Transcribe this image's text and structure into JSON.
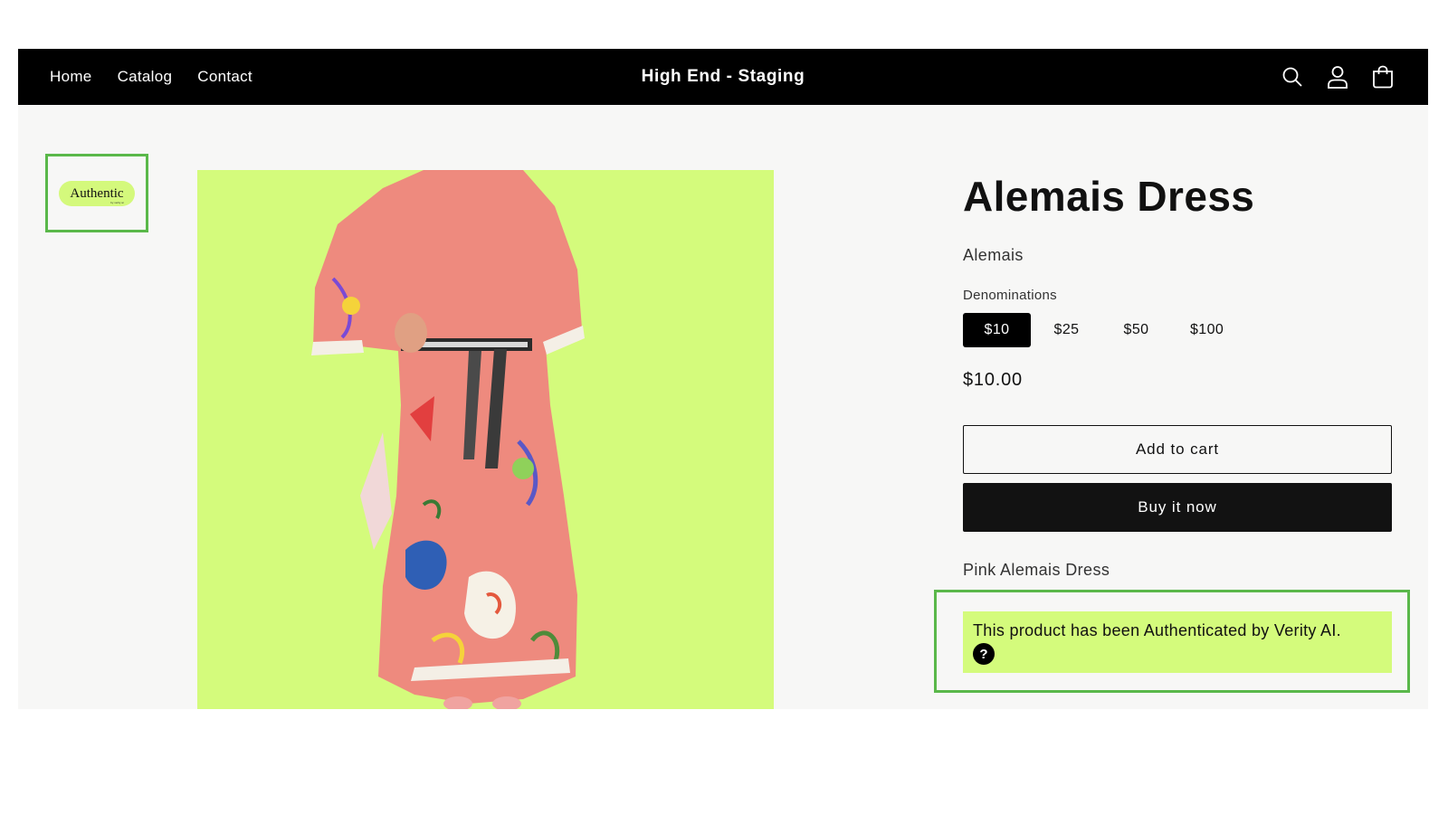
{
  "header": {
    "nav": [
      {
        "label": "Home"
      },
      {
        "label": "Catalog"
      },
      {
        "label": "Contact"
      }
    ],
    "brand": "High End - Staging",
    "icons": [
      "search-icon",
      "account-icon",
      "cart-icon"
    ]
  },
  "gallery": {
    "thumbnail_badge": "Authentic",
    "thumbnail_badge_subtext": "by verity ai"
  },
  "product": {
    "title": "Alemais Dress",
    "vendor": "Alemais",
    "option_label": "Denominations",
    "options": [
      {
        "label": "$10",
        "selected": true
      },
      {
        "label": "$25",
        "selected": false
      },
      {
        "label": "$50",
        "selected": false
      },
      {
        "label": "$100",
        "selected": false
      }
    ],
    "price": "$10.00",
    "add_to_cart": "Add to cart",
    "buy_now": "Buy it now",
    "description": "Pink Alemais Dress"
  },
  "authentication": {
    "message": "This product has been Authenticated by Verity AI.",
    "help_glyph": "?"
  },
  "colors": {
    "header_bg": "#000000",
    "accent_lime": "#d4fb7c",
    "highlight_green": "#5ab84a",
    "page_bg": "#f7f7f6"
  }
}
